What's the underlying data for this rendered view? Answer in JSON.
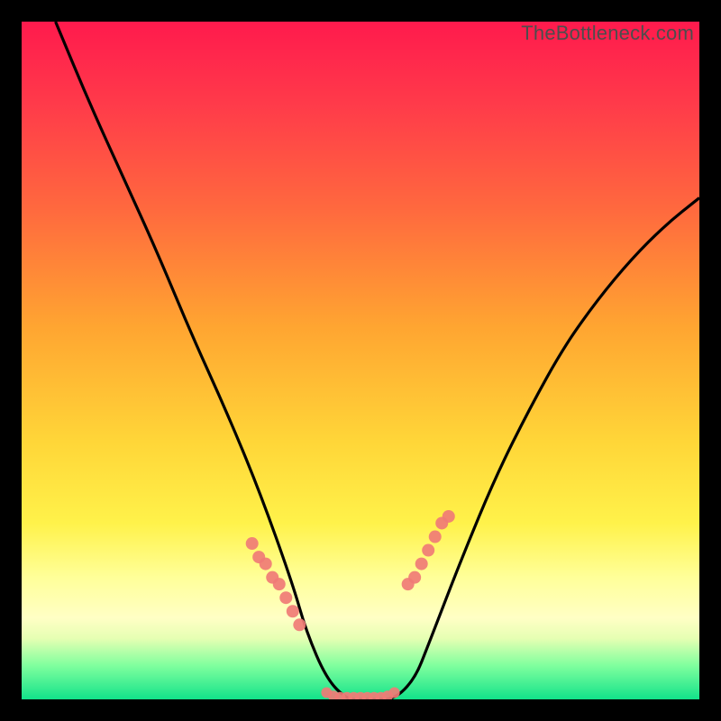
{
  "watermark": "TheBottleneck.com",
  "chart_data": {
    "type": "line",
    "title": "",
    "xlabel": "",
    "ylabel": "",
    "xlim": [
      0,
      100
    ],
    "ylim": [
      0,
      100
    ],
    "x": [
      5,
      10,
      15,
      20,
      25,
      30,
      35,
      40,
      42,
      45,
      48,
      50,
      52,
      55,
      58,
      60,
      65,
      70,
      75,
      80,
      85,
      90,
      95,
      100
    ],
    "values": [
      100,
      88,
      77,
      66,
      54,
      43,
      31,
      17,
      10,
      3,
      0,
      0,
      0,
      0,
      3,
      8,
      21,
      33,
      43,
      52,
      59,
      65,
      70,
      74
    ],
    "markers_left": {
      "x": [
        34,
        35,
        36,
        37,
        38,
        39,
        40,
        41
      ],
      "y": [
        23,
        21,
        20,
        18,
        17,
        15,
        13,
        11
      ]
    },
    "markers_right": {
      "x": [
        57,
        58,
        59,
        60,
        61,
        62,
        63
      ],
      "y": [
        17,
        18,
        20,
        22,
        24,
        26,
        27
      ]
    },
    "plateau": {
      "x": [
        45,
        46,
        47,
        48,
        49,
        50,
        51,
        52,
        53,
        54,
        55
      ],
      "y": [
        1,
        0.5,
        0.3,
        0.3,
        0.3,
        0.3,
        0.3,
        0.3,
        0.3,
        0.5,
        1
      ]
    },
    "gradient_stops": [
      {
        "pct": 0,
        "color": "#ff1a4d"
      },
      {
        "pct": 50,
        "color": "#ffd638"
      },
      {
        "pct": 88,
        "color": "#ffffc5"
      },
      {
        "pct": 100,
        "color": "#12e28a"
      }
    ]
  }
}
